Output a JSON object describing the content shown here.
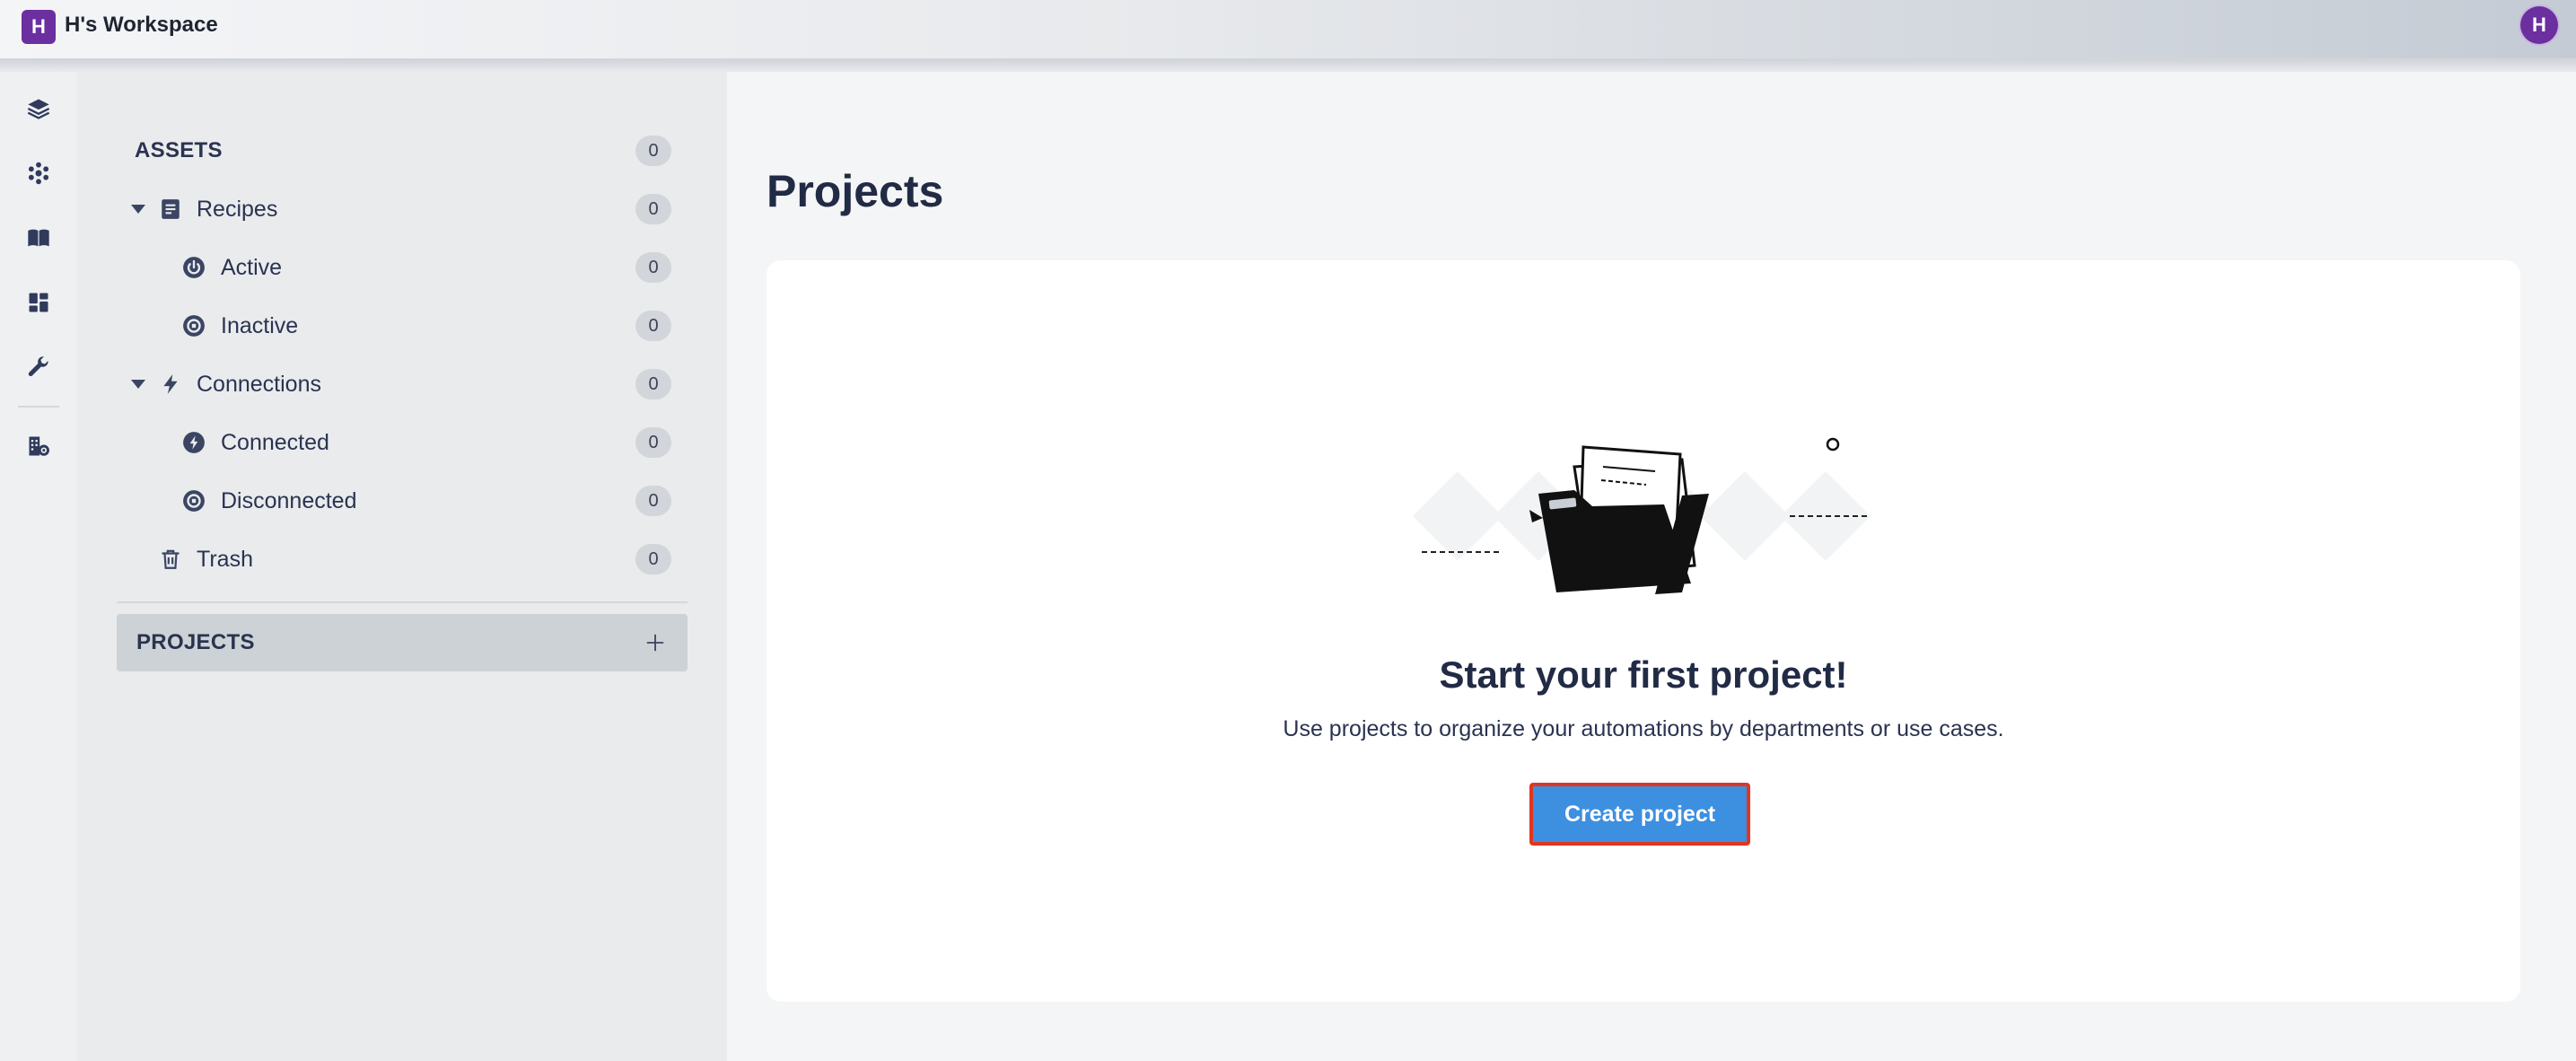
{
  "topbar": {
    "workspace_initial": "H",
    "workspace_name": "H's Workspace",
    "user_initial": "H",
    "accent_color": "#6b2fa0"
  },
  "rail": {
    "icons": [
      "layers-icon",
      "asterisk-icon",
      "book-icon",
      "dashboard-icon",
      "wrench-icon",
      "building-gear-icon"
    ]
  },
  "sidebar": {
    "assets": {
      "label": "ASSETS",
      "count": "0"
    },
    "recipes": {
      "label": "Recipes",
      "count": "0",
      "icon": "document-icon"
    },
    "active": {
      "label": "Active",
      "count": "0",
      "icon": "power-icon"
    },
    "inactive": {
      "label": "Inactive",
      "count": "0",
      "icon": "stop-icon"
    },
    "connections": {
      "label": "Connections",
      "count": "0",
      "icon": "lightning-icon"
    },
    "connected": {
      "label": "Connected",
      "count": "0",
      "icon": "lightning-circle-icon"
    },
    "disconnected": {
      "label": "Disconnected",
      "count": "0",
      "icon": "stop-icon"
    },
    "trash": {
      "label": "Trash",
      "count": "0",
      "icon": "trash-icon"
    },
    "projects": {
      "label": "PROJECTS",
      "add_icon": "plus-icon"
    }
  },
  "main": {
    "title": "Projects",
    "empty_state": {
      "title": "Start your first project!",
      "description": "Use projects to organize your automations by departments or use cases.",
      "button_label": "Create project",
      "button_color": "#3d8fe0",
      "highlight_color": "#e0361f"
    }
  }
}
